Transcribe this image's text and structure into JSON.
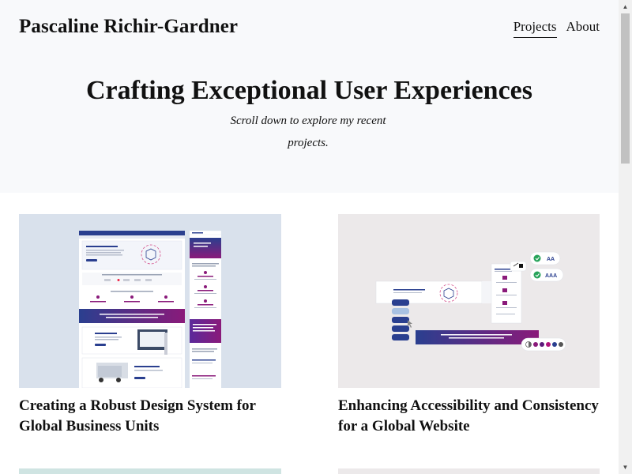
{
  "header": {
    "site_title": "Pascaline Richir-Gardner",
    "nav": [
      {
        "label": "Projects",
        "active": true
      },
      {
        "label": "About",
        "active": false
      }
    ]
  },
  "hero": {
    "heading": "Crafting Exceptional User Experiences",
    "subheading": "Scroll down to explore my recent projects."
  },
  "projects": [
    {
      "title": "Creating a Robust Design System for Global Business Units",
      "thumbnail_color": "#d9e1ec"
    },
    {
      "title": "Enhancing Accessibility and Consistency for a Global Website",
      "thumbnail_color": "#ece9ea"
    }
  ],
  "thumbnail_right": {
    "badge_aa": "AA",
    "badge_aaa": "AAA"
  },
  "colors": {
    "brand_purple": "#8a1a7a",
    "brand_blue": "#2a3f8f",
    "check_green": "#27a35a",
    "hero_bg": "#f8f9fb"
  },
  "scrollbar": {
    "up_icon": "triangle-up-icon",
    "down_icon": "triangle-down-icon"
  }
}
